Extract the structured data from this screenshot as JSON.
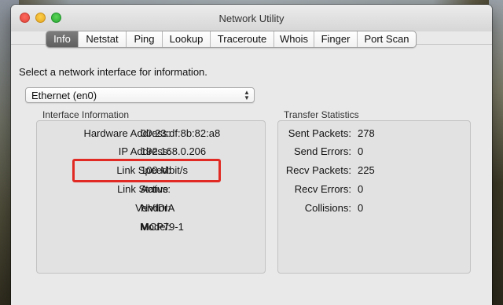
{
  "window": {
    "title": "Network Utility"
  },
  "tabs": [
    {
      "label": "Info",
      "active": true
    },
    {
      "label": "Netstat",
      "active": false
    },
    {
      "label": "Ping",
      "active": false
    },
    {
      "label": "Lookup",
      "active": false
    },
    {
      "label": "Traceroute",
      "active": false
    },
    {
      "label": "Whois",
      "active": false
    },
    {
      "label": "Finger",
      "active": false
    },
    {
      "label": "Port Scan",
      "active": false
    }
  ],
  "info": {
    "prompt": "Select a network interface for information.",
    "interface_selected": "Ethernet (en0)",
    "interface_info": {
      "title": "Interface Information",
      "rows": [
        {
          "label": "Hardware Address:",
          "value": "00:23:df:8b:82:a8"
        },
        {
          "label": "IP Address:",
          "value": "192.168.0.206"
        },
        {
          "label": "Link Speed:",
          "value": "100 Mbit/s"
        },
        {
          "label": "Link Status:",
          "value": "Active"
        },
        {
          "label": "Vendor:",
          "value": "NVIDIA"
        },
        {
          "label": "Model:",
          "value": "MCP79-1"
        }
      ]
    },
    "transfer_stats": {
      "title": "Transfer Statistics",
      "rows": [
        {
          "label": "Sent Packets:",
          "value": "278"
        },
        {
          "label": "Send Errors:",
          "value": "0"
        },
        {
          "label": "Recv Packets:",
          "value": "225"
        },
        {
          "label": "Recv Errors:",
          "value": "0"
        },
        {
          "label": "Collisions:",
          "value": "0"
        }
      ]
    }
  },
  "colors": {
    "highlight": "#e02a23",
    "active_tab": "#6a6a6a"
  }
}
